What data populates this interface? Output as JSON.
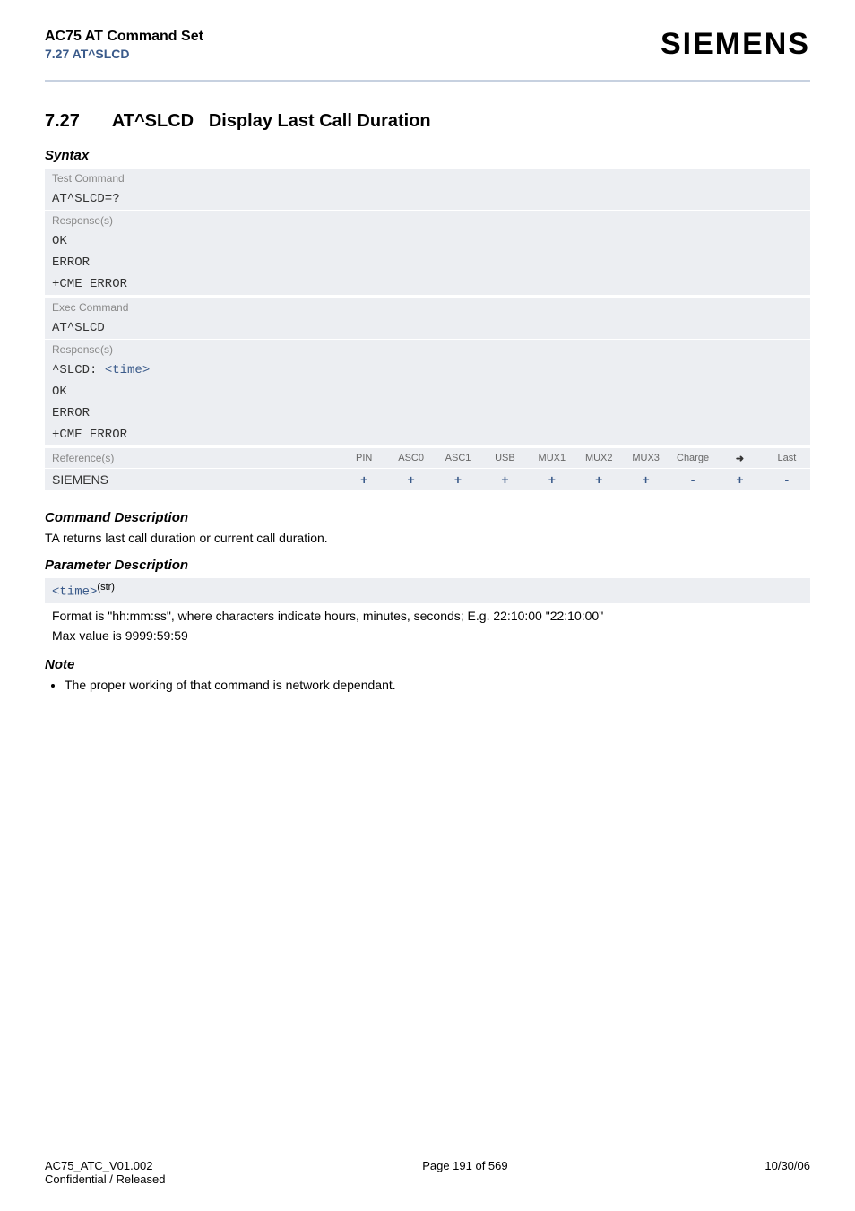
{
  "header": {
    "title": "AC75 AT Command Set",
    "subtitle": "7.27 AT^SLCD",
    "brand": "SIEMENS"
  },
  "section": {
    "number": "7.27",
    "cmd": "AT^SLCD",
    "desc": "Display Last Call Duration"
  },
  "syntax": {
    "heading": "Syntax",
    "test_label": "Test Command",
    "test_cmd": "AT^SLCD=?",
    "resp_label": "Response(s)",
    "test_resp": [
      "OK",
      "ERROR",
      "+CME ERROR"
    ],
    "exec_label": "Exec Command",
    "exec_cmd": "AT^SLCD",
    "exec_resp_prefix": "^SLCD: ",
    "exec_resp_param": "<time>",
    "exec_resp_rest": [
      "OK",
      "ERROR",
      "+CME ERROR"
    ]
  },
  "refs": {
    "label": "Reference(s)",
    "vendor": "SIEMENS",
    "cols": [
      "PIN",
      "ASC0",
      "ASC1",
      "USB",
      "MUX1",
      "MUX2",
      "MUX3",
      "Charge",
      "➜",
      "Last"
    ],
    "vals": [
      "+",
      "+",
      "+",
      "+",
      "+",
      "+",
      "+",
      "-",
      "+",
      "-"
    ]
  },
  "command_description": {
    "heading": "Command Description",
    "text": "TA returns last call duration or current call duration."
  },
  "param": {
    "heading": "Parameter Description",
    "name": "<time>",
    "type": "(str)",
    "line1": "Format is \"hh:mm:ss\", where characters indicate hours, minutes, seconds; E.g. 22:10:00 \"22:10:00\"",
    "line2": "Max value is 9999:59:59"
  },
  "note": {
    "heading": "Note",
    "items": [
      "The proper working of that command is network dependant."
    ]
  },
  "footer": {
    "left1": "AC75_ATC_V01.002",
    "left2": "Confidential / Released",
    "center": "Page 191 of 569",
    "right": "10/30/06"
  }
}
